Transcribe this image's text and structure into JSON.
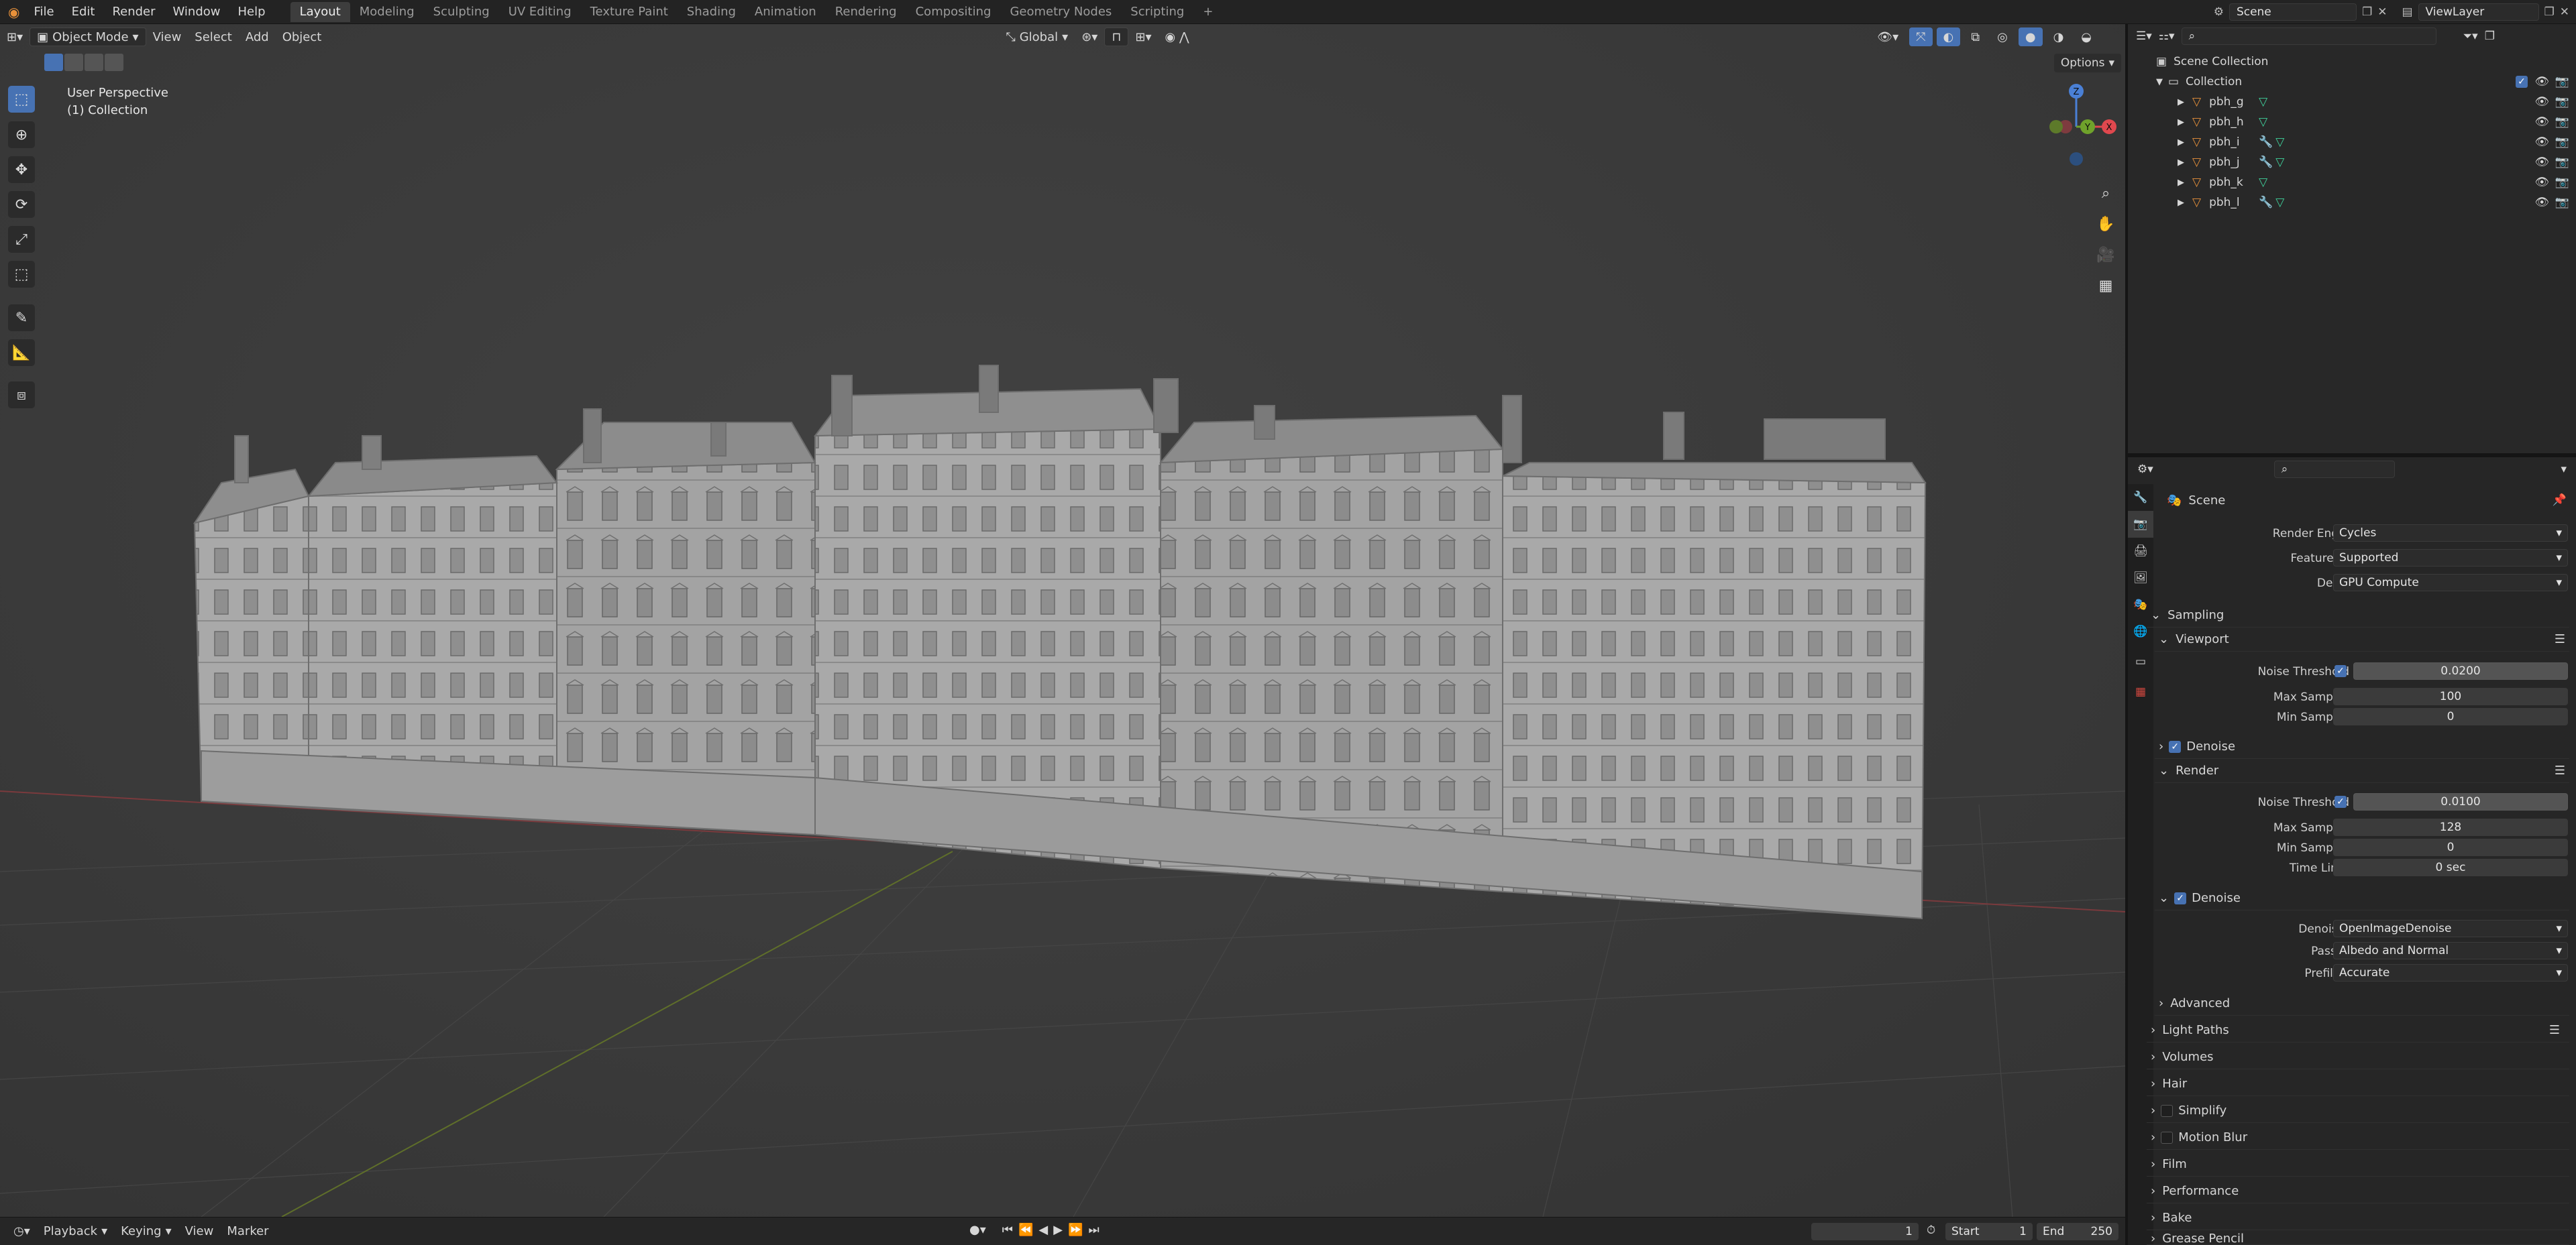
{
  "topbar": {
    "menus": [
      "File",
      "Edit",
      "Render",
      "Window",
      "Help"
    ],
    "workspaces": [
      "Layout",
      "Modeling",
      "Sculpting",
      "UV Editing",
      "Texture Paint",
      "Shading",
      "Animation",
      "Rendering",
      "Compositing",
      "Geometry Nodes",
      "Scripting"
    ],
    "active_workspace": "Layout",
    "add_tab": "+",
    "scene": "Scene",
    "view_layer": "ViewLayer"
  },
  "viewport": {
    "mode": "Object Mode",
    "menus": [
      "View",
      "Select",
      "Add",
      "Object"
    ],
    "orientation": "Global",
    "options": "Options",
    "overlay_title": "User Perspective",
    "overlay_sub": "(1) Collection",
    "gizmo_axes": {
      "z": "Z",
      "y": "Y",
      "x": "X"
    }
  },
  "outliner": {
    "root": "Scene Collection",
    "collection": "Collection",
    "objects": [
      {
        "name": "pbh_g",
        "modifier": false
      },
      {
        "name": "pbh_h",
        "modifier": false
      },
      {
        "name": "pbh_i",
        "modifier": true
      },
      {
        "name": "pbh_j",
        "modifier": true
      },
      {
        "name": "pbh_k",
        "modifier": false
      },
      {
        "name": "pbh_l",
        "modifier": true
      }
    ]
  },
  "properties": {
    "context": "Scene",
    "render_engine_label": "Render Engine",
    "render_engine": "Cycles",
    "feature_set_label": "Feature Set",
    "feature_set": "Supported",
    "device_label": "Device",
    "device": "GPU Compute",
    "sampling": "Sampling",
    "viewport": "Viewport",
    "noise_threshold_label": "Noise Threshold",
    "viewport_noise_threshold": "0.0200",
    "max_samples_label": "Max Samples",
    "viewport_max_samples": "100",
    "min_samples_label": "Min Samples",
    "viewport_min_samples": "0",
    "denoise": "Denoise",
    "render": "Render",
    "render_noise_threshold": "0.0100",
    "render_max_samples": "128",
    "render_min_samples": "0",
    "time_limit_label": "Time Limit",
    "time_limit": "0 sec",
    "denoiser_label": "Denoiser",
    "denoiser": "OpenImageDenoise",
    "passes_label": "Passes",
    "passes": "Albedo and Normal",
    "prefilter_label": "Prefilter",
    "prefilter": "Accurate",
    "advanced": "Advanced",
    "panels": [
      "Light Paths",
      "Volumes",
      "Hair",
      "Simplify",
      "Motion Blur",
      "Film",
      "Performance",
      "Bake",
      "Grease Pencil"
    ]
  },
  "timeline": {
    "menus": [
      "Playback",
      "Keying",
      "View",
      "Marker"
    ],
    "current_frame": "1",
    "start_label": "Start",
    "start": "1",
    "end_label": "End",
    "end": "250"
  },
  "colors": {
    "accent": "#4772b3",
    "x_axis": "#e0484e",
    "y_axis": "#6fa22b",
    "z_axis": "#4a80d6",
    "object_orange": "#e8913a",
    "mesh_green": "#3fd19b"
  }
}
